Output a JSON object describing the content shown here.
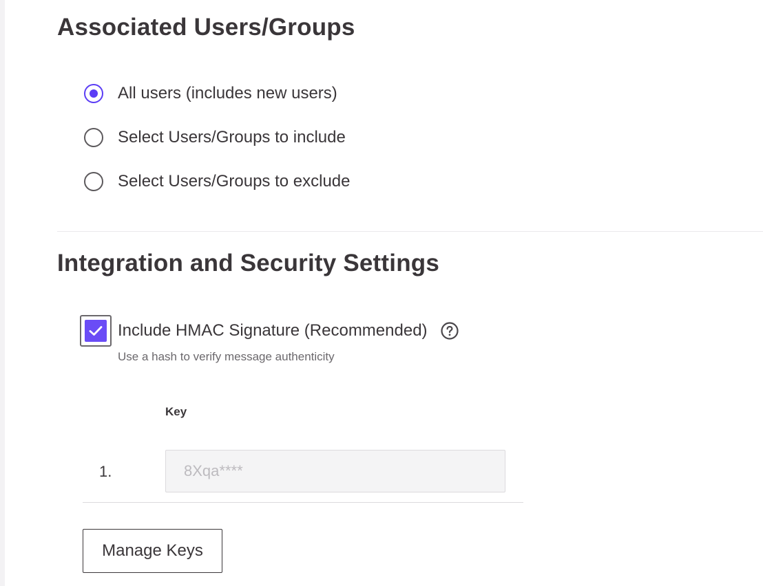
{
  "users_section": {
    "title": "Associated Users/Groups",
    "options": [
      {
        "label": "All users (includes new users)",
        "checked": true
      },
      {
        "label": "Select Users/Groups to include",
        "checked": false
      },
      {
        "label": "Select Users/Groups to exclude",
        "checked": false
      }
    ]
  },
  "security_section": {
    "title": "Integration and Security Settings",
    "hmac": {
      "label": "Include HMAC Signature (Recommended)",
      "checked": true,
      "hint": "Use a hash to verify message authenticity",
      "help_icon": "question-circle-icon"
    },
    "keys_table": {
      "header": "Key",
      "rows": [
        {
          "index": "1.",
          "value": "8Xqa****"
        }
      ]
    },
    "manage_button_label": "Manage Keys"
  },
  "colors": {
    "accent": "#5b3df5",
    "checkbox_fill": "#6a4cf6",
    "text": "#3a3639",
    "muted_text": "#6b686c"
  }
}
